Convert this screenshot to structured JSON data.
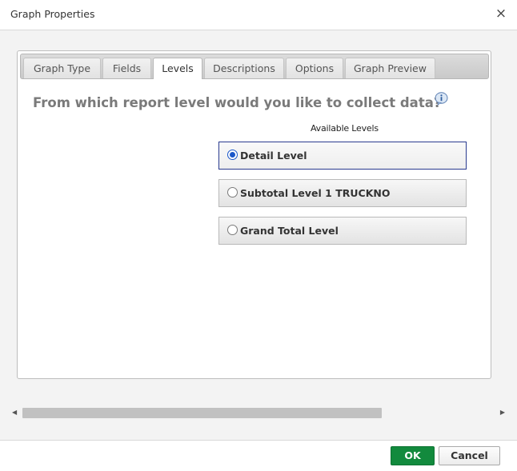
{
  "dialog": {
    "title": "Graph Properties",
    "close_glyph": "×"
  },
  "tabs": [
    {
      "label": "Graph Type",
      "active": false
    },
    {
      "label": "Fields",
      "active": false
    },
    {
      "label": "Levels",
      "active": true
    },
    {
      "label": "Descriptions",
      "active": false
    },
    {
      "label": "Options",
      "active": false
    },
    {
      "label": "Graph Preview",
      "active": false
    }
  ],
  "levels_panel": {
    "question": "From which report level would you like to collect data?",
    "info_icon": "info-icon",
    "heading": "Available Levels",
    "options": [
      {
        "label": "Detail Level",
        "selected": true
      },
      {
        "label": "Subtotal Level 1 TRUCKNO",
        "selected": false
      },
      {
        "label": " Grand Total Level",
        "selected": false
      }
    ]
  },
  "scrollbar": {
    "left_arrow": "◀",
    "right_arrow": "▶"
  },
  "footer": {
    "ok_label": "OK",
    "cancel_label": "Cancel"
  },
  "colors": {
    "ok_button": "#128a3d",
    "selected_border": "#2a3b8f",
    "radio_selected": "#1a57c9"
  }
}
